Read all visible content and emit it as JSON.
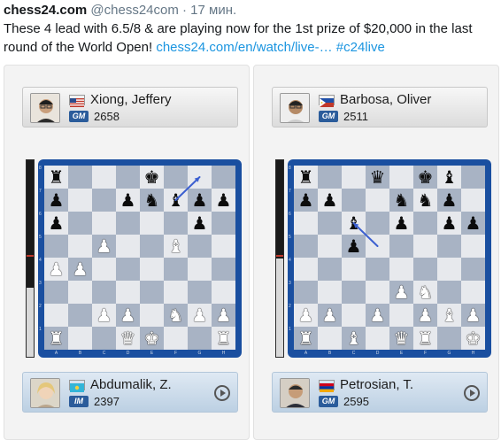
{
  "tweet": {
    "author": "chess24.com",
    "handle": "@chess24com",
    "time": "· 17 мин.",
    "text": "These 4 lead with 6.5/8 & are playing now for the 1st prize of $20,000 in the last round of the World Open!",
    "link": "chess24.com/en/watch/live-…",
    "hashtag": "#c24live"
  },
  "boards": [
    {
      "top_player": {
        "name": "Xiong, Jeffery",
        "title": "GM",
        "rating": "2658",
        "flag": "us-flag-icon"
      },
      "bottom_player": {
        "name": "Abdumalik, Z.",
        "title": "IM",
        "rating": "2397",
        "flag": "kz-flag-icon"
      },
      "eval_white_fraction": 0.35,
      "position": [
        "r...k...",
        "p..pnbpp",
        "p.....p.",
        "..P..B..",
        "PP......",
        "........",
        "..PP.NPP",
        "R..QK..R"
      ],
      "last_move_arrow": {
        "from": "f7",
        "to": "g8"
      }
    },
    {
      "top_player": {
        "name": "Barbosa, Oliver",
        "title": "GM",
        "rating": "2511",
        "flag": "ph-flag-icon"
      },
      "bottom_player": {
        "name": "Petrosian, T.",
        "title": "GM",
        "rating": "2595",
        "flag": "am-flag-icon"
      },
      "eval_white_fraction": 0.5,
      "position": [
        "r..q.kb.",
        "pp..nnp.",
        "..b.p.pp",
        "..p.....",
        "........",
        "....PN..",
        "PP.P.PBP",
        "R.B.QR.K"
      ],
      "last_move_arrow": {
        "from": "d5",
        "to": "c6"
      }
    }
  ],
  "files": [
    "A",
    "B",
    "C",
    "D",
    "E",
    "F",
    "G",
    "H"
  ],
  "ranks": [
    "8",
    "7",
    "6",
    "5",
    "4",
    "3",
    "2",
    "1"
  ]
}
